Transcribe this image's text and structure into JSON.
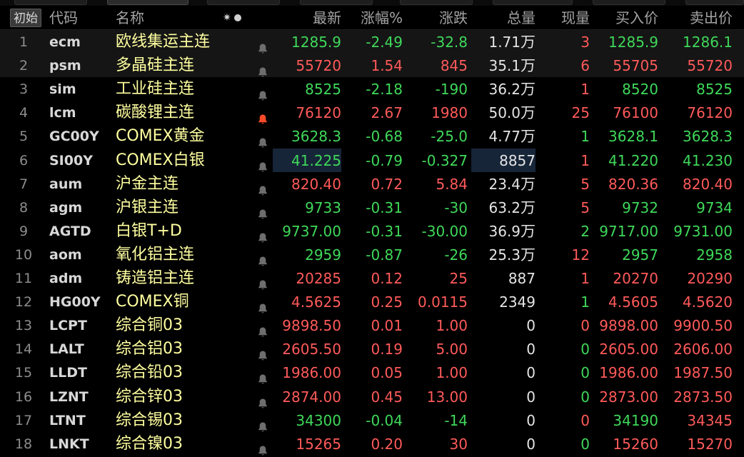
{
  "header": {
    "init_button": "初始",
    "columns": [
      "代码",
      "名称",
      "最新",
      "涨幅%",
      "涨跌",
      "总量",
      "现量",
      "买入价",
      "卖出价"
    ],
    "icons": [
      "gear-icon",
      "dot-icon"
    ]
  },
  "colors": {
    "up": "#ff5a5a",
    "down": "#3fd85a",
    "name": "#ffffa0",
    "bell": "#6e6e6e",
    "bell_alert": "#ff4a2a",
    "highlight_bg": "#172538"
  },
  "rows": [
    {
      "idx": "1",
      "code": "ecm",
      "name": "欧线集运主连",
      "alert": false,
      "latest": "1285.9",
      "pct": "-2.49",
      "chg": "-32.8",
      "vol": "1.71",
      "vol_unit": "万",
      "cur": "3",
      "bid": "1285.9",
      "ask": "1286.1",
      "latest_dir": "dn",
      "pct_dir": "dn",
      "chg_dir": "dn",
      "cur_dir": "up",
      "bid_dir": "dn",
      "ask_dir": "dn"
    },
    {
      "idx": "2",
      "code": "psm",
      "name": "多晶硅主连",
      "alert": false,
      "latest": "55720",
      "pct": "1.54",
      "chg": "845",
      "vol": "35.1",
      "vol_unit": "万",
      "cur": "6",
      "bid": "55705",
      "ask": "55720",
      "latest_dir": "up",
      "pct_dir": "up",
      "chg_dir": "up",
      "cur_dir": "up",
      "bid_dir": "up",
      "ask_dir": "up"
    },
    {
      "idx": "3",
      "code": "sim",
      "name": "工业硅主连",
      "alert": false,
      "latest": "8525",
      "pct": "-2.18",
      "chg": "-190",
      "vol": "36.2",
      "vol_unit": "万",
      "cur": "1",
      "bid": "8520",
      "ask": "8525",
      "latest_dir": "dn",
      "pct_dir": "dn",
      "chg_dir": "dn",
      "cur_dir": "up",
      "bid_dir": "dn",
      "ask_dir": "dn"
    },
    {
      "idx": "4",
      "code": "lcm",
      "name": "碳酸锂主连",
      "alert": true,
      "latest": "76120",
      "pct": "2.67",
      "chg": "1980",
      "vol": "50.0",
      "vol_unit": "万",
      "cur": "25",
      "bid": "76100",
      "ask": "76120",
      "latest_dir": "up",
      "pct_dir": "up",
      "chg_dir": "up",
      "cur_dir": "up",
      "bid_dir": "up",
      "ask_dir": "up"
    },
    {
      "idx": "5",
      "code": "GC00Y",
      "name": "COMEX黄金",
      "alert": false,
      "latest": "3628.3",
      "pct": "-0.68",
      "chg": "-25.0",
      "vol": "4.77",
      "vol_unit": "万",
      "cur": "1",
      "bid": "3628.1",
      "ask": "3628.3",
      "latest_dir": "dn",
      "pct_dir": "dn",
      "chg_dir": "dn",
      "cur_dir": "dn",
      "bid_dir": "dn",
      "ask_dir": "dn"
    },
    {
      "idx": "6",
      "code": "SI00Y",
      "name": "COMEX白银",
      "alert": false,
      "latest": "41.225",
      "pct": "-0.79",
      "chg": "-0.327",
      "vol": "8857",
      "vol_unit": "",
      "cur": "1",
      "bid": "41.220",
      "ask": "41.230",
      "latest_dir": "dn",
      "pct_dir": "dn",
      "chg_dir": "dn",
      "cur_dir": "up",
      "bid_dir": "dn",
      "ask_dir": "dn",
      "highlight": true
    },
    {
      "idx": "7",
      "code": "aum",
      "name": "沪金主连",
      "alert": false,
      "latest": "820.40",
      "pct": "0.72",
      "chg": "5.84",
      "vol": "23.4",
      "vol_unit": "万",
      "cur": "5",
      "bid": "820.36",
      "ask": "820.40",
      "latest_dir": "up",
      "pct_dir": "up",
      "chg_dir": "up",
      "cur_dir": "up",
      "bid_dir": "up",
      "ask_dir": "up"
    },
    {
      "idx": "8",
      "code": "agm",
      "name": "沪银主连",
      "alert": false,
      "latest": "9733",
      "pct": "-0.31",
      "chg": "-30",
      "vol": "63.2",
      "vol_unit": "万",
      "cur": "5",
      "bid": "9732",
      "ask": "9734",
      "latest_dir": "dn",
      "pct_dir": "dn",
      "chg_dir": "dn",
      "cur_dir": "up",
      "bid_dir": "dn",
      "ask_dir": "dn"
    },
    {
      "idx": "9",
      "code": "AGTD",
      "name": "白银T+D",
      "alert": false,
      "latest": "9737.00",
      "pct": "-0.31",
      "chg": "-30.00",
      "vol": "36.9",
      "vol_unit": "万",
      "cur": "2",
      "bid": "9717.00",
      "ask": "9731.00",
      "latest_dir": "dn",
      "pct_dir": "dn",
      "chg_dir": "dn",
      "cur_dir": "dn",
      "bid_dir": "dn",
      "ask_dir": "dn"
    },
    {
      "idx": "10",
      "code": "aom",
      "name": "氧化铝主连",
      "alert": false,
      "latest": "2959",
      "pct": "-0.87",
      "chg": "-26",
      "vol": "25.3",
      "vol_unit": "万",
      "cur": "12",
      "bid": "2957",
      "ask": "2958",
      "latest_dir": "dn",
      "pct_dir": "dn",
      "chg_dir": "dn",
      "cur_dir": "up",
      "bid_dir": "dn",
      "ask_dir": "dn"
    },
    {
      "idx": "11",
      "code": "adm",
      "name": "铸造铝主连",
      "alert": false,
      "latest": "20285",
      "pct": "0.12",
      "chg": "25",
      "vol": "887",
      "vol_unit": "",
      "cur": "1",
      "bid": "20270",
      "ask": "20290",
      "latest_dir": "up",
      "pct_dir": "up",
      "chg_dir": "up",
      "cur_dir": "up",
      "bid_dir": "up",
      "ask_dir": "up"
    },
    {
      "idx": "12",
      "code": "HG00Y",
      "name": "COMEX铜",
      "alert": false,
      "latest": "4.5625",
      "pct": "0.25",
      "chg": "0.0115",
      "vol": "2349",
      "vol_unit": "",
      "cur": "1",
      "bid": "4.5605",
      "ask": "4.5620",
      "latest_dir": "up",
      "pct_dir": "up",
      "chg_dir": "up",
      "cur_dir": "dn",
      "bid_dir": "up",
      "ask_dir": "up"
    },
    {
      "idx": "13",
      "code": "LCPT",
      "name": "综合铜03",
      "alert": false,
      "latest": "9898.50",
      "pct": "0.01",
      "chg": "1.00",
      "vol": "0",
      "vol_unit": "",
      "cur": "0",
      "bid": "9898.00",
      "ask": "9900.50",
      "latest_dir": "up",
      "pct_dir": "up",
      "chg_dir": "up",
      "cur_dir": "up",
      "bid_dir": "up",
      "ask_dir": "up"
    },
    {
      "idx": "14",
      "code": "LALT",
      "name": "综合铝03",
      "alert": false,
      "latest": "2605.50",
      "pct": "0.19",
      "chg": "5.00",
      "vol": "0",
      "vol_unit": "",
      "cur": "0",
      "bid": "2605.00",
      "ask": "2606.00",
      "latest_dir": "up",
      "pct_dir": "up",
      "chg_dir": "up",
      "cur_dir": "dn",
      "bid_dir": "up",
      "ask_dir": "up"
    },
    {
      "idx": "15",
      "code": "LLDT",
      "name": "综合铅03",
      "alert": false,
      "latest": "1986.00",
      "pct": "0.05",
      "chg": "1.00",
      "vol": "0",
      "vol_unit": "",
      "cur": "0",
      "bid": "1986.00",
      "ask": "1987.50",
      "latest_dir": "up",
      "pct_dir": "up",
      "chg_dir": "up",
      "cur_dir": "dn",
      "bid_dir": "up",
      "ask_dir": "up"
    },
    {
      "idx": "16",
      "code": "LZNT",
      "name": "综合锌03",
      "alert": false,
      "latest": "2874.00",
      "pct": "0.45",
      "chg": "13.00",
      "vol": "0",
      "vol_unit": "",
      "cur": "0",
      "bid": "2873.00",
      "ask": "2873.50",
      "latest_dir": "up",
      "pct_dir": "up",
      "chg_dir": "up",
      "cur_dir": "dn",
      "bid_dir": "up",
      "ask_dir": "up"
    },
    {
      "idx": "17",
      "code": "LTNT",
      "name": "综合锡03",
      "alert": false,
      "latest": "34300",
      "pct": "-0.04",
      "chg": "-14",
      "vol": "0",
      "vol_unit": "",
      "cur": "0",
      "bid": "34190",
      "ask": "34345",
      "latest_dir": "dn",
      "pct_dir": "dn",
      "chg_dir": "dn",
      "cur_dir": "up",
      "bid_dir": "dn",
      "ask_dir": "up"
    },
    {
      "idx": "18",
      "code": "LNKT",
      "name": "综合镍03",
      "alert": false,
      "latest": "15265",
      "pct": "0.20",
      "chg": "30",
      "vol": "0",
      "vol_unit": "",
      "cur": "0",
      "bid": "15260",
      "ask": "15270",
      "latest_dir": "up",
      "pct_dir": "up",
      "chg_dir": "up",
      "cur_dir": "dn",
      "bid_dir": "up",
      "ask_dir": "up"
    }
  ]
}
